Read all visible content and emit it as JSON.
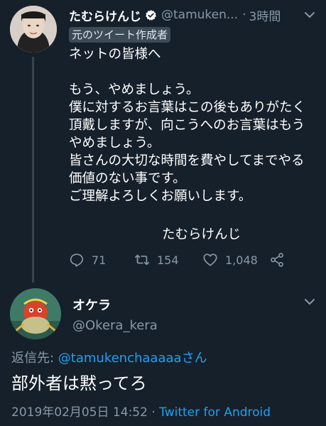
{
  "tweet": {
    "author_name": "たむらけんじ",
    "author_handle": "@tamuken...",
    "separator": "·",
    "time": "3時間",
    "author_badge": "元のツイート作成者",
    "lines": [
      "ネットの皆様へ",
      "",
      "もう、やめましょう。",
      "僕に対するお言葉はこの後もありがたく",
      "頂戴しますが、向こうへのお言葉はもう",
      "やめましょう。",
      "皆さんの大切な時間を費やしてまでやる",
      "価値のない事です。",
      "ご理解よろしくお願いします。"
    ],
    "signature": "たむらけんじ",
    "replies": "71",
    "retweets": "154",
    "likes": "1,048"
  },
  "reply": {
    "author_name": "オケラ",
    "author_handle": "@Okera_kera",
    "reply_to_prefix": "返信先: ",
    "reply_to_handle": "@tamukenchaaaaa",
    "reply_to_suffix": "さん",
    "text": "部外者は黙ってろ",
    "timestamp": "2019年02月05日 14:52",
    "meta_separator": " · ",
    "client": "Twitter for Android"
  },
  "colors": {
    "background": "#15202b",
    "secondary_text": "#8899a6",
    "link": "#1da1f2",
    "verified": "#ffffff"
  },
  "icons": {
    "verified": "verified-badge-icon",
    "reply": "reply-icon",
    "retweet": "retweet-icon",
    "like": "heart-icon",
    "share": "share-icon",
    "menu": "chevron-down-icon"
  }
}
